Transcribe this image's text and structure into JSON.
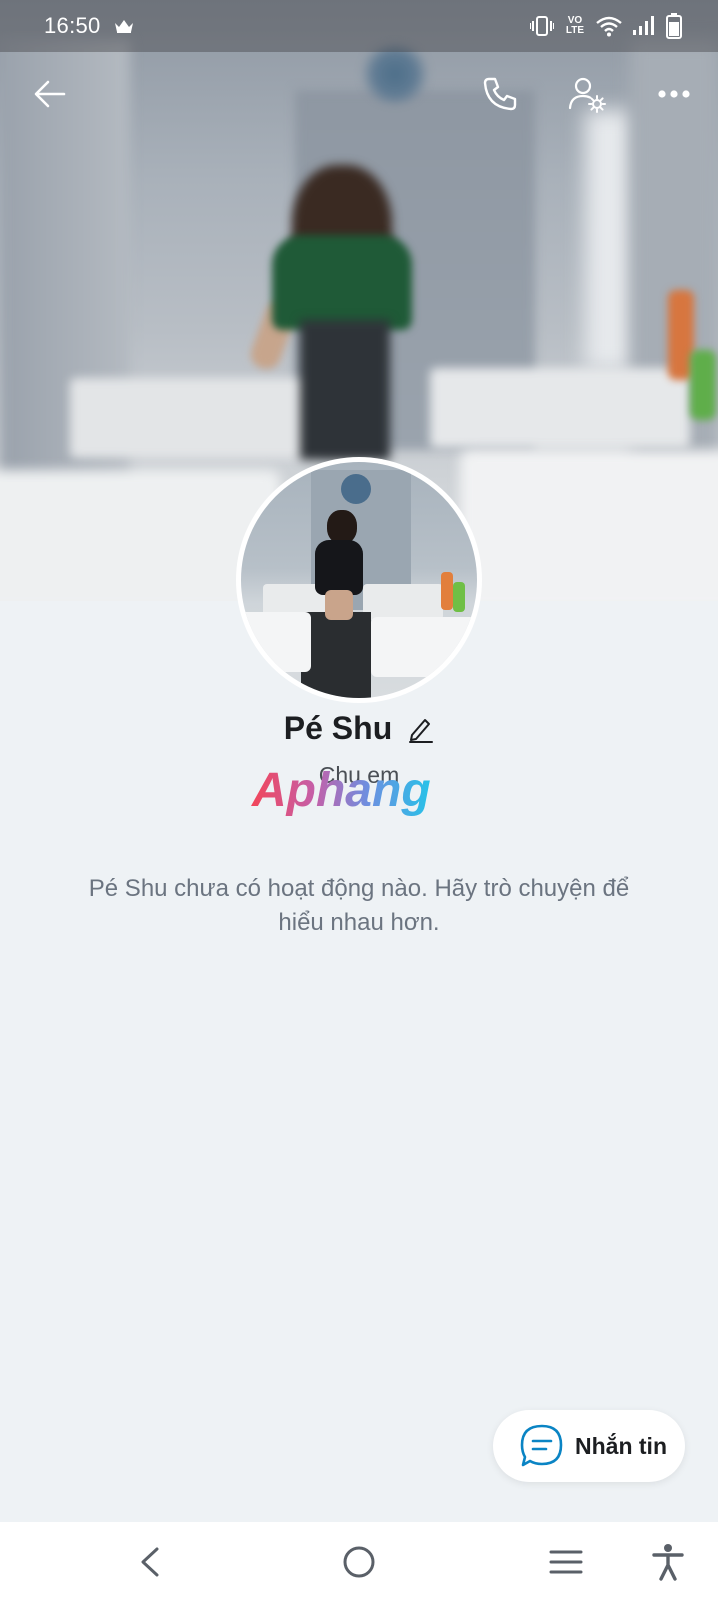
{
  "status_bar": {
    "time": "16:50",
    "network_label": "VO LTE",
    "icons": [
      "crown-icon",
      "vibrate-icon",
      "volte-icon",
      "wifi-icon",
      "signal-icon",
      "battery-icon"
    ]
  },
  "header": {
    "icons": [
      "back-arrow-icon",
      "phone-icon",
      "user-settings-icon",
      "more-icon"
    ]
  },
  "profile": {
    "name": "Pé Shu",
    "bio": "Chu em",
    "edit_icon": "pencil-icon"
  },
  "watermark": {
    "text": "Aphang"
  },
  "empty_state": {
    "message": "Pé Shu chưa có hoạt động nào. Hãy trò chuyện để hiểu nhau hơn."
  },
  "message_button": {
    "label": "Nhắn tin",
    "icon": "chat-bubble-icon"
  },
  "nav_bar": {
    "icons": [
      "nav-back-icon",
      "nav-home-icon",
      "nav-recents-icon",
      "accessibility-icon"
    ]
  },
  "colors": {
    "accent": "#0a84c4",
    "background": "#eef2f5",
    "text_primary": "#1c1e21",
    "text_secondary": "#6b7480"
  }
}
